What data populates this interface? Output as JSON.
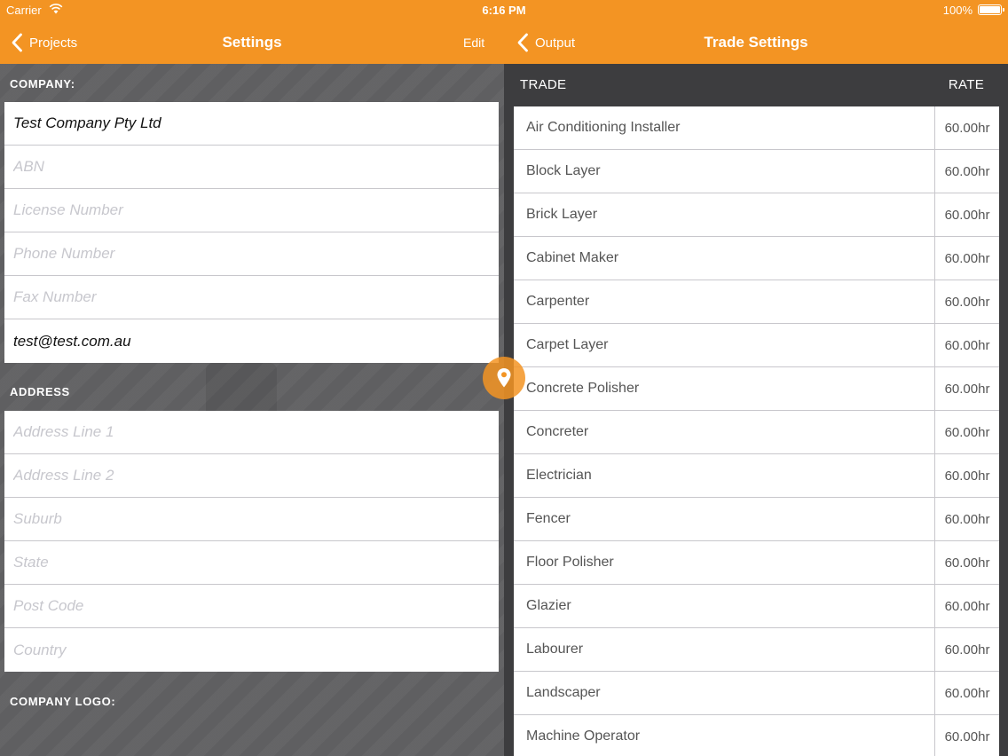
{
  "status_bar": {
    "carrier": "Carrier",
    "time": "6:16 PM",
    "battery": "100%"
  },
  "left_nav": {
    "back_label": "Projects",
    "title": "Settings",
    "edit_label": "Edit"
  },
  "right_nav": {
    "back_label": "Output",
    "title": "Trade Settings"
  },
  "company": {
    "header": "COMPANY:",
    "fields": [
      {
        "value": "Test Company Pty Ltd",
        "placeholder": ""
      },
      {
        "value": "",
        "placeholder": "ABN"
      },
      {
        "value": "",
        "placeholder": "License Number"
      },
      {
        "value": "",
        "placeholder": "Phone Number"
      },
      {
        "value": "",
        "placeholder": "Fax Number"
      },
      {
        "value": "test@test.com.au",
        "placeholder": ""
      }
    ]
  },
  "address": {
    "header": "ADDRESS",
    "fields": [
      {
        "value": "",
        "placeholder": "Address Line 1"
      },
      {
        "value": "",
        "placeholder": "Address Line 2"
      },
      {
        "value": "",
        "placeholder": "Suburb"
      },
      {
        "value": "",
        "placeholder": "State"
      },
      {
        "value": "",
        "placeholder": "Post Code"
      },
      {
        "value": "",
        "placeholder": "Country"
      }
    ]
  },
  "company_logo": {
    "header": "COMPANY LOGO:"
  },
  "trades": {
    "col_trade": "TRADE",
    "col_rate": "RATE",
    "rows": [
      {
        "name": "Air Conditioning Installer",
        "rate": "60.00hr"
      },
      {
        "name": "Block Layer",
        "rate": "60.00hr"
      },
      {
        "name": "Brick Layer",
        "rate": "60.00hr"
      },
      {
        "name": "Cabinet Maker",
        "rate": "60.00hr"
      },
      {
        "name": "Carpenter",
        "rate": "60.00hr"
      },
      {
        "name": "Carpet Layer",
        "rate": "60.00hr"
      },
      {
        "name": "Concrete Polisher",
        "rate": "60.00hr"
      },
      {
        "name": "Concreter",
        "rate": "60.00hr"
      },
      {
        "name": "Electrician",
        "rate": "60.00hr"
      },
      {
        "name": "Fencer",
        "rate": "60.00hr"
      },
      {
        "name": "Floor Polisher",
        "rate": "60.00hr"
      },
      {
        "name": "Glazier",
        "rate": "60.00hr"
      },
      {
        "name": "Labourer",
        "rate": "60.00hr"
      },
      {
        "name": "Landscaper",
        "rate": "60.00hr"
      },
      {
        "name": "Machine Operator",
        "rate": "60.00hr"
      }
    ]
  },
  "colors": {
    "accent": "#f39423",
    "left_bg": "#5f5f61",
    "right_bg": "#3d3d3f"
  },
  "icons": [
    "wifi-icon",
    "battery-icon",
    "chevron-left-icon",
    "location-pin-icon"
  ]
}
